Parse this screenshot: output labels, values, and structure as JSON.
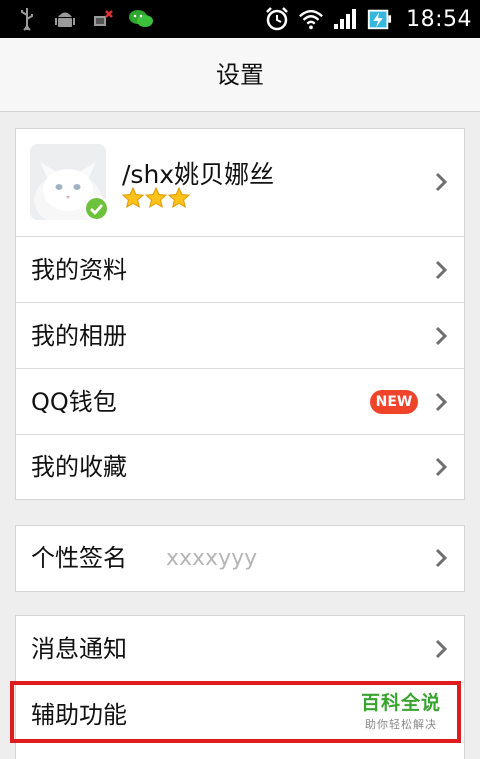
{
  "status_bar": {
    "time": "18:54",
    "icons": [
      "usb-icon",
      "android-debug-icon",
      "sim-alert-icon",
      "wechat-icon",
      "alarm-icon",
      "wifi-icon",
      "signal-icon",
      "battery-charging-icon"
    ]
  },
  "header": {
    "title": "设置"
  },
  "profile": {
    "name": "/shx姚贝娜丝",
    "stars": 3,
    "avatar": "white-cat-avatar"
  },
  "group1": {
    "items": [
      {
        "label": "我的资料"
      },
      {
        "label": "我的相册"
      },
      {
        "label": "QQ钱包",
        "badge": "NEW"
      },
      {
        "label": "我的收藏"
      }
    ]
  },
  "signature": {
    "label": "个性签名",
    "value": "xxxxyyy"
  },
  "group3": {
    "items": [
      {
        "label": "消息通知"
      },
      {
        "label": "辅助功能"
      }
    ]
  },
  "watermark": {
    "title": "百科全说",
    "subtitle": "助你轻松解决"
  },
  "colors": {
    "accent_red": "#f0442a",
    "highlight_red": "#e01b1b",
    "watermark_green": "#3aa32f"
  }
}
